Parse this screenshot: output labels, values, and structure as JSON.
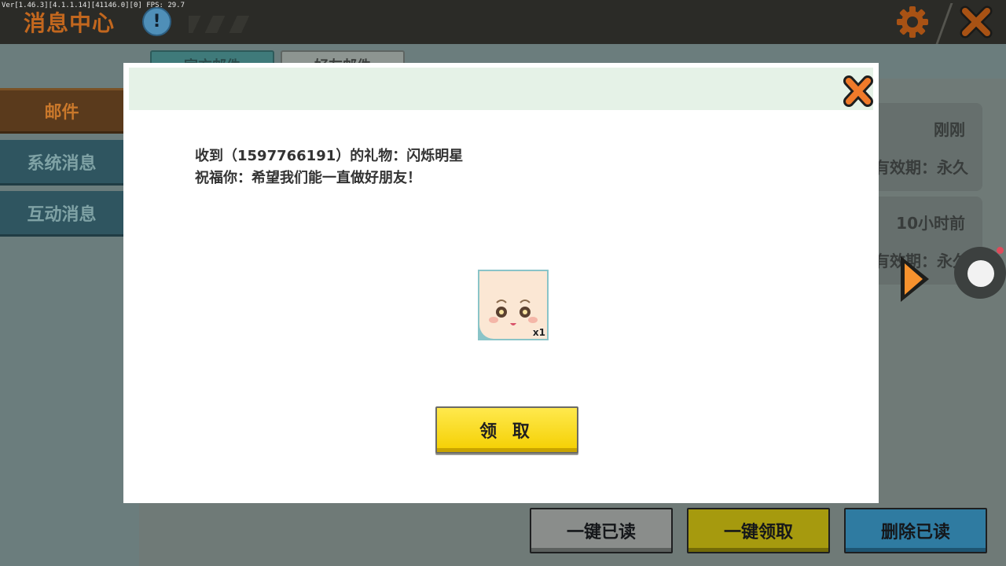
{
  "app": {
    "version_text": "Ver[1.46.3][4.1.1.14][41146.0][0] FPS: 29.7",
    "title": "消息中心",
    "info_label": "!"
  },
  "sidebar": {
    "items": [
      {
        "label": "邮件",
        "selected": true
      },
      {
        "label": "系统消息",
        "selected": false
      },
      {
        "label": "互动消息",
        "selected": false
      }
    ]
  },
  "tabs": [
    {
      "label": "官方邮件",
      "selected": true
    },
    {
      "label": "好友邮件",
      "selected": false
    }
  ],
  "mail_list": [
    {
      "time": "刚刚",
      "validity": "有效期：永久"
    },
    {
      "time": "10小时前",
      "validity": "有效期：永久"
    }
  ],
  "bottom_buttons": {
    "mark_all_read": "一键已读",
    "claim_all": "一键领取",
    "delete_read": "删除已读"
  },
  "dialog": {
    "line1": "收到（1597766191）的礼物：闪烁明星",
    "line2": "祝福你：希望我们能一直做好朋友！",
    "gift": {
      "name": "avatar-face",
      "count": "x1"
    },
    "claim_label": "领 取"
  },
  "colors": {
    "accent_orange": "#f07a2a",
    "claim_yellow": "#ffe23a",
    "header_green": "#e5f2e7"
  }
}
